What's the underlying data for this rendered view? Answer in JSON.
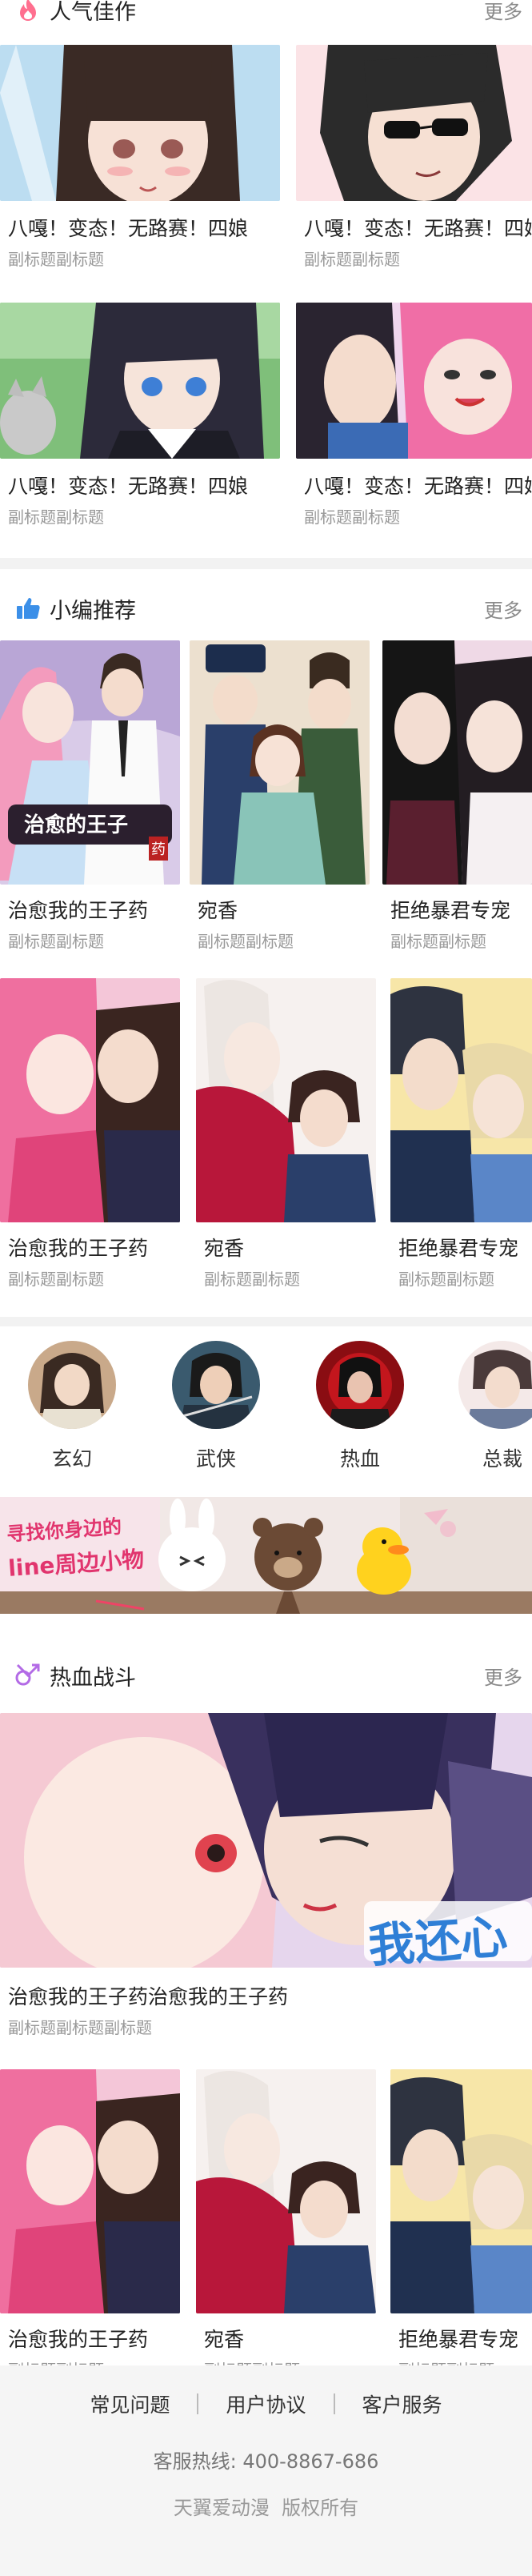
{
  "popular": {
    "title": "人气佳作",
    "more": "更多",
    "items": [
      {
        "title": "八嘎！变态！无路赛！四娘",
        "subtitle": "副标题副标题"
      },
      {
        "title": "八嘎！变态！无路赛！四娘",
        "subtitle": "副标题副标题"
      },
      {
        "title": "八嘎！变态！无路赛！四娘",
        "subtitle": "副标题副标题"
      },
      {
        "title": "八嘎！变态！无路赛！四娘",
        "subtitle": "副标题副标题"
      }
    ]
  },
  "editor_picks": {
    "title": "小编推荐",
    "more": "更多",
    "items": [
      {
        "title": "治愈我的王子药",
        "subtitle": "副标题副标题"
      },
      {
        "title": "宛香",
        "subtitle": "副标题副标题"
      },
      {
        "title": "拒绝暴君专宠",
        "subtitle": "副标题副标题"
      },
      {
        "title": "治愈我的王子药",
        "subtitle": "副标题副标题"
      },
      {
        "title": "宛香",
        "subtitle": "副标题副标题"
      },
      {
        "title": "拒绝暴君专宠",
        "subtitle": "副标题副标题"
      }
    ],
    "cover_texts": [
      "治愈的王子",
      "药"
    ]
  },
  "categories": [
    {
      "label": "玄幻"
    },
    {
      "label": "武侠"
    },
    {
      "label": "热血"
    },
    {
      "label": "总裁"
    }
  ],
  "banner": {
    "line1": "寻找你身边的",
    "line2": "line周边小物"
  },
  "hot_battle": {
    "title": "热血战斗",
    "more": "更多",
    "feature": {
      "title": "治愈我的王子药治愈我的王子药",
      "subtitle": "副标题副标题副标题",
      "overlay_text": "我还心"
    },
    "items": [
      {
        "title": "治愈我的王子药",
        "subtitle": "副标题副标题"
      },
      {
        "title": "宛香",
        "subtitle": "副标题副标题"
      },
      {
        "title": "拒绝暴君专宠",
        "subtitle": "副标题副标题"
      }
    ]
  },
  "footer": {
    "links": [
      "常见问题",
      "用户协议",
      "客户服务"
    ],
    "hotline_label": "客服热线:",
    "hotline": "400-8867-686",
    "copyright": "天翼爱动漫  版权所有"
  },
  "colors": {
    "accent_pink": "#ff6f8f",
    "accent_blue": "#3b8fe8",
    "accent_purple": "#b36be6",
    "text_primary": "#222222",
    "text_secondary": "#999999",
    "separator": "#f2f2f2"
  },
  "icons": {
    "popular": "flame-icon",
    "editor_picks": "thumbs-up-icon",
    "hot_battle": "swords-icon"
  }
}
